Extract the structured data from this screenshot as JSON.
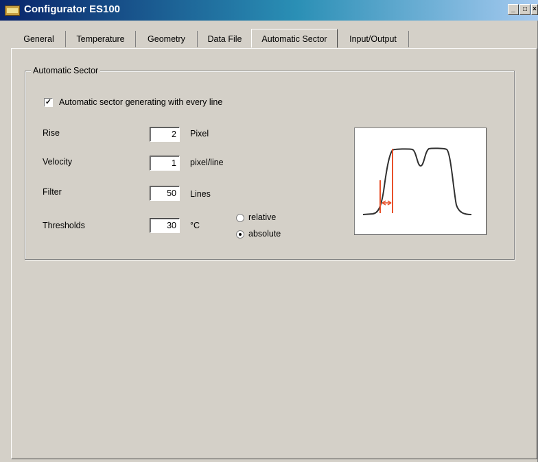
{
  "window": {
    "title": "Configurator ES100"
  },
  "title_buttons": {
    "minimize": "_",
    "maximize": "□",
    "close": "×"
  },
  "tabs": [
    {
      "label": "General"
    },
    {
      "label": "Temperature"
    },
    {
      "label": "Geometry"
    },
    {
      "label": "Data File"
    },
    {
      "label": "Automatic Sector",
      "active": true
    },
    {
      "label": "Input/Output"
    }
  ],
  "group": {
    "title": "Automatic Sector",
    "checkbox": {
      "label": "Automatic sector generating with every line",
      "checked": true,
      "mark": "✓"
    },
    "fields": [
      {
        "label": "Rise",
        "value": "2",
        "unit": "Pixel"
      },
      {
        "label": "Velocity",
        "value": "1",
        "unit": "pixel/line"
      },
      {
        "label": "Filter",
        "value": "50",
        "unit": "Lines"
      },
      {
        "label": "Thresholds",
        "value": "30",
        "unit": "°C"
      }
    ],
    "threshold_mode": {
      "options": [
        {
          "label": "relative",
          "selected": false
        },
        {
          "label": "absolute",
          "selected": true
        }
      ]
    }
  },
  "colors": {
    "title_start": "#0a246a",
    "title_end": "#a6caf0",
    "marker": "#e8502a",
    "face": "#d4d0c8"
  }
}
